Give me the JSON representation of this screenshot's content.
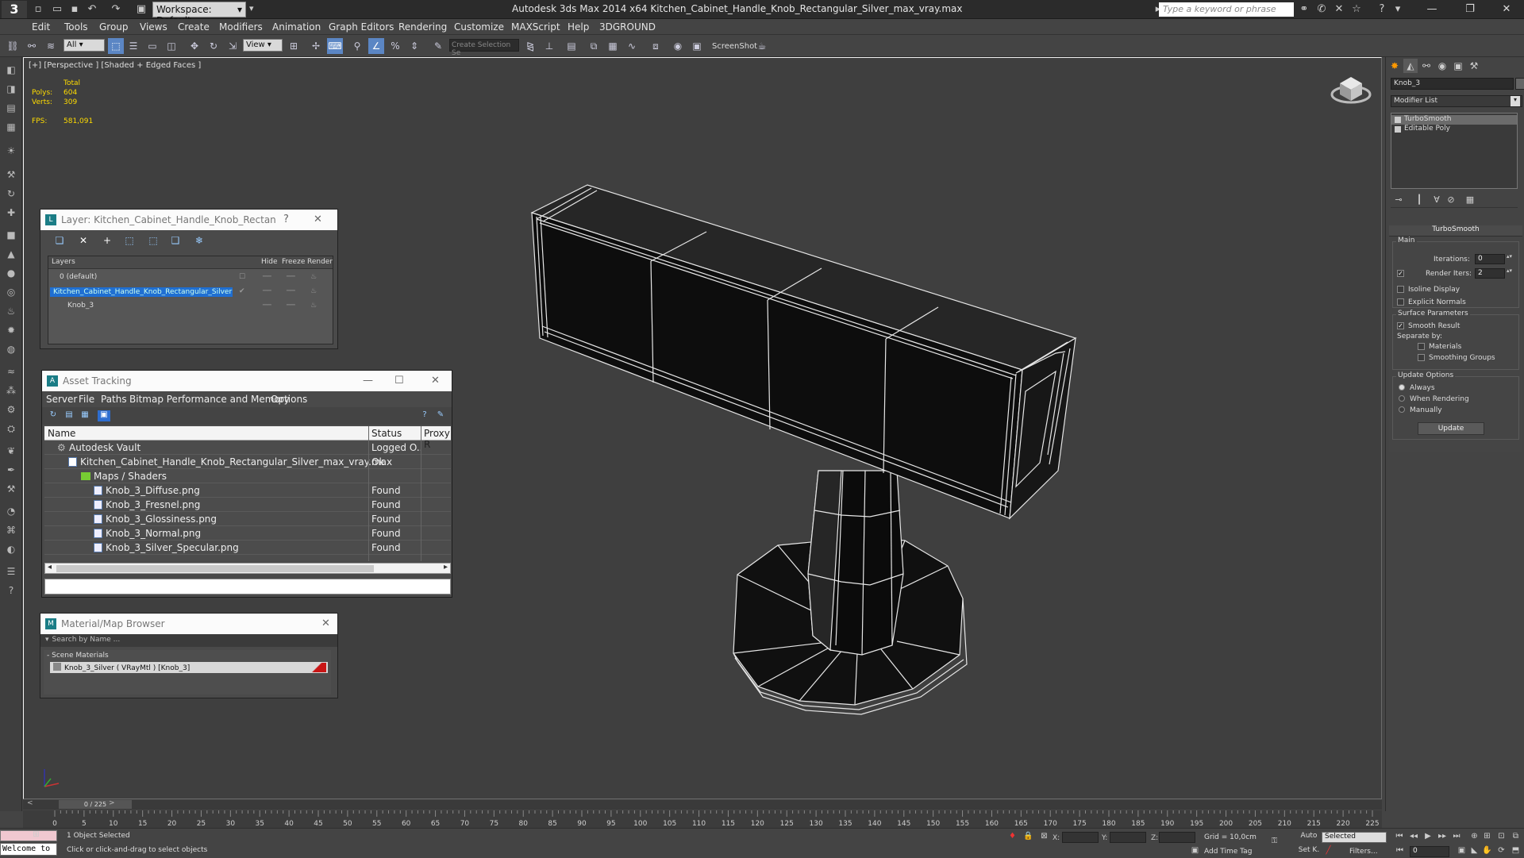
{
  "app": {
    "title": "Autodesk 3ds Max  2014 x64     Kitchen_Cabinet_Handle_Knob_Rectangular_Silver_max_vray.max",
    "logo": "3",
    "workspace": "Workspace: Default",
    "search_placeholder": "Type a keyword or phrase"
  },
  "menu": [
    "Edit",
    "Tools",
    "Group",
    "Views",
    "Create",
    "Modifiers",
    "Animation",
    "Graph Editors",
    "Rendering",
    "Customize",
    "MAXScript",
    "Help",
    "3DGROUND"
  ],
  "toolbar": {
    "filter": "All",
    "ref_coord": "View",
    "selection_set": "Create Selection Se",
    "screenshot": "ScreenShot"
  },
  "viewport": {
    "label": "[+] [Perspective ] [Shaded + Edged Faces ]",
    "stats_total": "Total",
    "polys_label": "Polys:",
    "polys": "604",
    "verts_label": "Verts:",
    "verts": "309",
    "fps_label": "FPS:",
    "fps": "581,091"
  },
  "layer_panel": {
    "title": "Layer: Kitchen_Cabinet_Handle_Knob_Rectangular_...",
    "help": "?",
    "columns": [
      "Layers",
      "Hide",
      "Freeze",
      "Render"
    ],
    "rows": [
      {
        "name": "0 (default)"
      },
      {
        "name": "Kitchen_Cabinet_Handle_Knob_Rectangular_Silver"
      },
      {
        "name": "Knob_3"
      }
    ]
  },
  "asset_panel": {
    "title": "Asset Tracking",
    "menu": [
      "Server",
      "File",
      "Paths",
      "Bitmap Performance and Memory",
      "Options"
    ],
    "columns": [
      "Name",
      "Status",
      "Proxy R"
    ],
    "rows": [
      {
        "name": "Autodesk Vault",
        "status": "Logged O..."
      },
      {
        "name": "Kitchen_Cabinet_Handle_Knob_Rectangular_Silver_max_vray.max",
        "status": "Ok"
      },
      {
        "name": "Maps / Shaders",
        "status": ""
      },
      {
        "name": "Knob_3_Diffuse.png",
        "status": "Found"
      },
      {
        "name": "Knob_3_Fresnel.png",
        "status": "Found"
      },
      {
        "name": "Knob_3_Glossiness.png",
        "status": "Found"
      },
      {
        "name": "Knob_3_Normal.png",
        "status": "Found"
      },
      {
        "name": "Knob_3_Silver_Specular.png",
        "status": "Found"
      }
    ]
  },
  "material_panel": {
    "title": "Material/Map Browser",
    "search": "Search by Name ...",
    "group": "- Scene Materials",
    "material": "Knob_3_Silver  ( VRayMtl )  [Knob_3]",
    "swatch_color": "#c81515"
  },
  "command_panel": {
    "object_name": "Knob_3",
    "modifier_list": "Modifier List",
    "stack": [
      "TurboSmooth",
      "Editable Poly"
    ],
    "rollout": "TurboSmooth",
    "main": "Main",
    "iterations_label": "Iterations:",
    "iterations": "0",
    "render_iters_label": "Render Iters:",
    "render_iters": "2",
    "isoline": "Isoline Display",
    "explicit": "Explicit Normals",
    "surface": "Surface Parameters",
    "smooth_result": "Smooth Result",
    "separate_by": "Separate by:",
    "materials": "Materials",
    "smoothing_groups": "Smoothing Groups",
    "update_options": "Update Options",
    "always": "Always",
    "when_rendering": "When Rendering",
    "manually": "Manually",
    "update": "Update"
  },
  "timeline": {
    "frame": "0 / 225",
    "ticks": [
      0,
      5,
      10,
      15,
      20,
      25,
      30,
      35,
      40,
      45,
      50,
      55,
      60,
      65,
      70,
      75,
      80,
      85,
      90,
      95,
      100,
      105,
      110,
      115,
      120,
      125,
      130,
      135,
      140,
      145,
      150,
      155,
      160,
      165,
      170,
      175,
      180,
      185,
      190,
      195,
      200,
      205,
      210,
      215,
      220,
      225
    ]
  },
  "status": {
    "welcome": "Welcome to",
    "selected": "1 Object Selected",
    "prompt": "Click or click-and-drag to select objects",
    "x": "X:",
    "y": "Y:",
    "z": "Z:",
    "grid": "Grid = 10,0cm",
    "add_time_tag": "Add Time Tag",
    "auto": "Auto",
    "set_key": "Set K.",
    "key_filter": "Selected",
    "filters": "Filters...",
    "current_frame": "0"
  }
}
